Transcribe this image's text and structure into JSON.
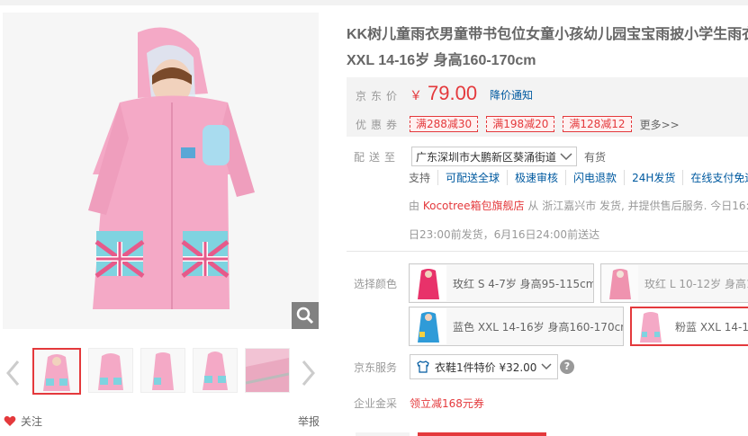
{
  "product": {
    "title_line1": "KK树儿童雨衣男童带书包位女童小孩幼儿园宝宝雨披小学生雨衣",
    "title_line2": "XXL 14-16岁 身高160-170cm"
  },
  "gallery": {
    "thumbnail_count": 5,
    "selected_index": 0
  },
  "price": {
    "label": "京东价",
    "currency": "￥",
    "value": "79.00",
    "notify_link": "降价通知"
  },
  "coupons": {
    "label": "优惠券",
    "items": [
      "满288减30",
      "满198减20",
      "满128减12"
    ],
    "more": "更多>>"
  },
  "shipping": {
    "label": "配送至",
    "address": "广东深圳市大鹏新区葵涌街道",
    "stock": "有货",
    "supports": [
      "支持",
      "可配送全球",
      "极速审核",
      "闪电退款",
      "24H发货",
      "在线支付免运费"
    ],
    "from_prefix": "由",
    "shop": "Kocotree箱包旗舰店",
    "from_suffix": "从 浙江嘉兴市 发货, 并提供售后服务. 今日16:00",
    "deliver_text": "日23:00前发货，6月16日24:00前送达"
  },
  "colors": {
    "label": "选择颜色",
    "options": [
      {
        "text": "玫红 S 4-7岁 身高95-115cm",
        "selected": false,
        "dimmed": false
      },
      {
        "text": "玫红 L 10-12岁 身高14",
        "selected": false,
        "dimmed": true
      },
      {
        "text": "蓝色 XXL 14-16岁 身高160-170cm",
        "selected": false,
        "dimmed": false
      },
      {
        "text": "粉蓝 XXL 14-16岁",
        "selected": true,
        "dimmed": false
      }
    ]
  },
  "service": {
    "label": "京东服务",
    "option": "衣鞋1件特价 ¥32.00",
    "help": "?"
  },
  "enterprise": {
    "label": "企业金采",
    "text": "领立减168元券"
  },
  "actions": {
    "follow": "关注",
    "report": "举报"
  },
  "colors_theme": {
    "accent": "#e4393c",
    "link": "#005aa0",
    "raincoat_pink": "#f4a9c6",
    "pocket_blue": "#7fd3e0"
  }
}
